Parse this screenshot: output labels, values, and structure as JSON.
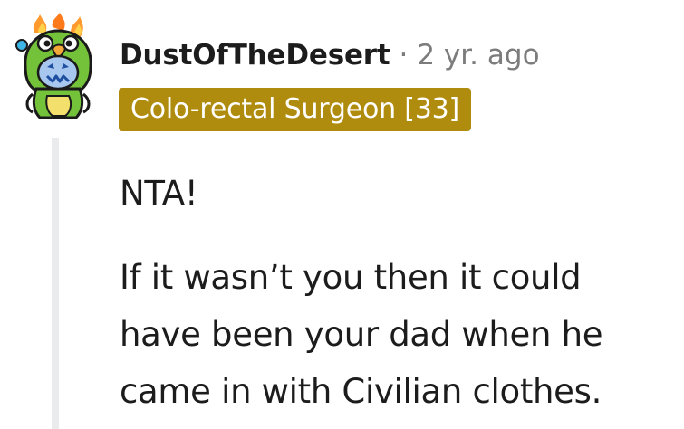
{
  "comment": {
    "username": "DustOfTheDesert",
    "separator": "·",
    "timestamp": "2 yr. ago",
    "flair": "Colo-rectal Surgeon [33]",
    "paragraphs": [
      "NTA!",
      "If it wasn’t you then it could have been your dad when he came in with Civilian clothes."
    ]
  },
  "colors": {
    "flair_background": "#b08c0e",
    "flair_text": "#ffffff",
    "thread_line": "#e9ebed",
    "meta_text": "#7c7c7c"
  },
  "icons": {
    "avatar": "parrot-costume-avatar-icon"
  }
}
